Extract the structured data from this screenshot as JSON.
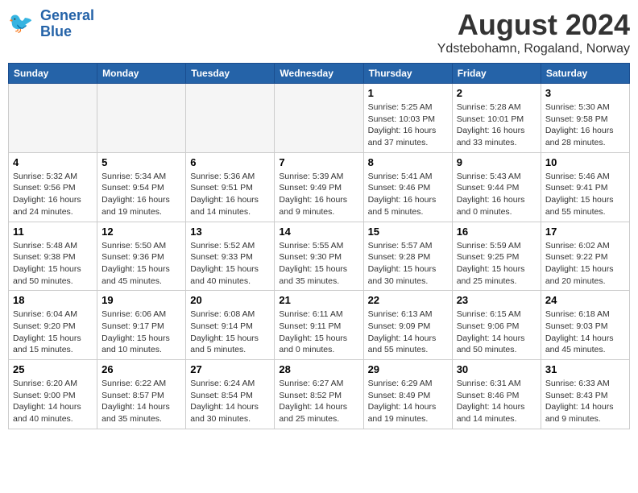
{
  "header": {
    "logo_line1": "General",
    "logo_line2": "Blue",
    "month_year": "August 2024",
    "location": "Ydstebohamn, Rogaland, Norway"
  },
  "weekdays": [
    "Sunday",
    "Monday",
    "Tuesday",
    "Wednesday",
    "Thursday",
    "Friday",
    "Saturday"
  ],
  "weeks": [
    [
      {
        "day": "",
        "info": ""
      },
      {
        "day": "",
        "info": ""
      },
      {
        "day": "",
        "info": ""
      },
      {
        "day": "",
        "info": ""
      },
      {
        "day": "1",
        "info": "Sunrise: 5:25 AM\nSunset: 10:03 PM\nDaylight: 16 hours\nand 37 minutes."
      },
      {
        "day": "2",
        "info": "Sunrise: 5:28 AM\nSunset: 10:01 PM\nDaylight: 16 hours\nand 33 minutes."
      },
      {
        "day": "3",
        "info": "Sunrise: 5:30 AM\nSunset: 9:58 PM\nDaylight: 16 hours\nand 28 minutes."
      }
    ],
    [
      {
        "day": "4",
        "info": "Sunrise: 5:32 AM\nSunset: 9:56 PM\nDaylight: 16 hours\nand 24 minutes."
      },
      {
        "day": "5",
        "info": "Sunrise: 5:34 AM\nSunset: 9:54 PM\nDaylight: 16 hours\nand 19 minutes."
      },
      {
        "day": "6",
        "info": "Sunrise: 5:36 AM\nSunset: 9:51 PM\nDaylight: 16 hours\nand 14 minutes."
      },
      {
        "day": "7",
        "info": "Sunrise: 5:39 AM\nSunset: 9:49 PM\nDaylight: 16 hours\nand 9 minutes."
      },
      {
        "day": "8",
        "info": "Sunrise: 5:41 AM\nSunset: 9:46 PM\nDaylight: 16 hours\nand 5 minutes."
      },
      {
        "day": "9",
        "info": "Sunrise: 5:43 AM\nSunset: 9:44 PM\nDaylight: 16 hours\nand 0 minutes."
      },
      {
        "day": "10",
        "info": "Sunrise: 5:46 AM\nSunset: 9:41 PM\nDaylight: 15 hours\nand 55 minutes."
      }
    ],
    [
      {
        "day": "11",
        "info": "Sunrise: 5:48 AM\nSunset: 9:38 PM\nDaylight: 15 hours\nand 50 minutes."
      },
      {
        "day": "12",
        "info": "Sunrise: 5:50 AM\nSunset: 9:36 PM\nDaylight: 15 hours\nand 45 minutes."
      },
      {
        "day": "13",
        "info": "Sunrise: 5:52 AM\nSunset: 9:33 PM\nDaylight: 15 hours\nand 40 minutes."
      },
      {
        "day": "14",
        "info": "Sunrise: 5:55 AM\nSunset: 9:30 PM\nDaylight: 15 hours\nand 35 minutes."
      },
      {
        "day": "15",
        "info": "Sunrise: 5:57 AM\nSunset: 9:28 PM\nDaylight: 15 hours\nand 30 minutes."
      },
      {
        "day": "16",
        "info": "Sunrise: 5:59 AM\nSunset: 9:25 PM\nDaylight: 15 hours\nand 25 minutes."
      },
      {
        "day": "17",
        "info": "Sunrise: 6:02 AM\nSunset: 9:22 PM\nDaylight: 15 hours\nand 20 minutes."
      }
    ],
    [
      {
        "day": "18",
        "info": "Sunrise: 6:04 AM\nSunset: 9:20 PM\nDaylight: 15 hours\nand 15 minutes."
      },
      {
        "day": "19",
        "info": "Sunrise: 6:06 AM\nSunset: 9:17 PM\nDaylight: 15 hours\nand 10 minutes."
      },
      {
        "day": "20",
        "info": "Sunrise: 6:08 AM\nSunset: 9:14 PM\nDaylight: 15 hours\nand 5 minutes."
      },
      {
        "day": "21",
        "info": "Sunrise: 6:11 AM\nSunset: 9:11 PM\nDaylight: 15 hours\nand 0 minutes."
      },
      {
        "day": "22",
        "info": "Sunrise: 6:13 AM\nSunset: 9:09 PM\nDaylight: 14 hours\nand 55 minutes."
      },
      {
        "day": "23",
        "info": "Sunrise: 6:15 AM\nSunset: 9:06 PM\nDaylight: 14 hours\nand 50 minutes."
      },
      {
        "day": "24",
        "info": "Sunrise: 6:18 AM\nSunset: 9:03 PM\nDaylight: 14 hours\nand 45 minutes."
      }
    ],
    [
      {
        "day": "25",
        "info": "Sunrise: 6:20 AM\nSunset: 9:00 PM\nDaylight: 14 hours\nand 40 minutes."
      },
      {
        "day": "26",
        "info": "Sunrise: 6:22 AM\nSunset: 8:57 PM\nDaylight: 14 hours\nand 35 minutes."
      },
      {
        "day": "27",
        "info": "Sunrise: 6:24 AM\nSunset: 8:54 PM\nDaylight: 14 hours\nand 30 minutes."
      },
      {
        "day": "28",
        "info": "Sunrise: 6:27 AM\nSunset: 8:52 PM\nDaylight: 14 hours\nand 25 minutes."
      },
      {
        "day": "29",
        "info": "Sunrise: 6:29 AM\nSunset: 8:49 PM\nDaylight: 14 hours\nand 19 minutes."
      },
      {
        "day": "30",
        "info": "Sunrise: 6:31 AM\nSunset: 8:46 PM\nDaylight: 14 hours\nand 14 minutes."
      },
      {
        "day": "31",
        "info": "Sunrise: 6:33 AM\nSunset: 8:43 PM\nDaylight: 14 hours\nand 9 minutes."
      }
    ]
  ]
}
